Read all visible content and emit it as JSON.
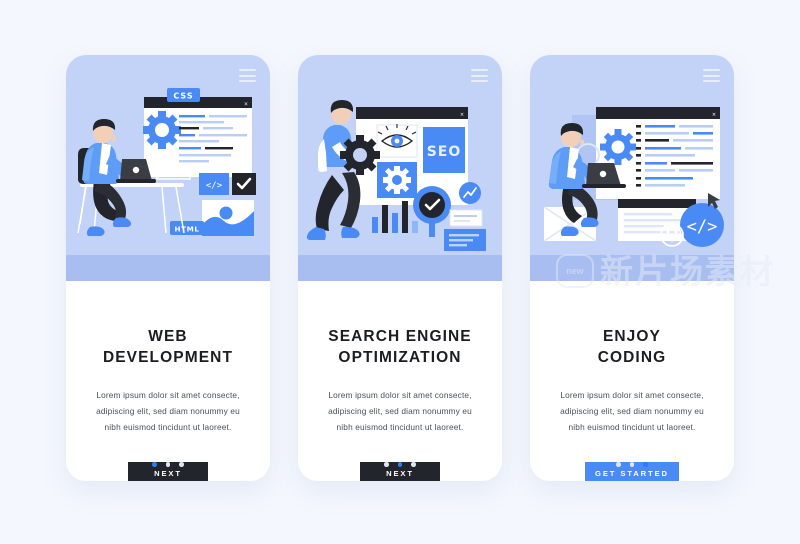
{
  "page": {
    "background_color": "#f4f7fd",
    "card_count": 3
  },
  "theme": {
    "hero_bg": "#c3d2f7",
    "floor_bg": "#a9bef0",
    "accent_blue": "#4a8af4",
    "dark_button": "#22252b",
    "text_dark": "#1b1d22",
    "text_body": "#4a4f5a",
    "dot_inactive": "#dfe4ef",
    "dot_active": "#2f7bf0"
  },
  "shared": {
    "menu_icon": "hamburger-menu-icon",
    "body_text": "Lorem ipsum dolor sit amet consecte,\nadipiscing elit, sed diam nonummy eu\nnibh euismod tincidunt ut laoreet."
  },
  "cards": [
    {
      "id": "web-development",
      "title": "WEB\nDEVELOPMENT",
      "body_text": "Lorem ipsum dolor sit amet consecte,\nadipiscing elit, sed diam nonummy eu\nnibh euismod tincidunt ut laoreet.",
      "button": {
        "label": "NEXT",
        "style": "dark"
      },
      "pagination": {
        "total": 3,
        "active_index": 0
      },
      "illustration": {
        "name": "developer-at-desk-illustration",
        "labels": [
          "CSS",
          "HTML",
          "</>"
        ],
        "elements": [
          "browser-window",
          "gear-icon",
          "laptop",
          "code-tile",
          "check-tile",
          "chart-card",
          "desk",
          "chair"
        ]
      }
    },
    {
      "id": "search-engine-optimization",
      "title": "SEARCH ENGINE\nOPTIMIZATION",
      "body_text": "Lorem ipsum dolor sit amet consecte,\nadipiscing elit, sed diam nonummy eu\nnibh euismod tincidunt ut laoreet.",
      "button": {
        "label": "NEXT",
        "style": "dark"
      },
      "pagination": {
        "total": 3,
        "active_index": 1
      },
      "illustration": {
        "name": "seo-analyst-illustration",
        "labels": [
          "SEO"
        ],
        "elements": [
          "browser-window",
          "eye-icon",
          "gear-icon-held",
          "gear-tile",
          "bar-chart",
          "check-badge",
          "trend-badge",
          "document-card"
        ]
      }
    },
    {
      "id": "enjoy-coding",
      "title": "ENJOY\nCODING",
      "body_text": "Lorem ipsum dolor sit amet consecte,\nadipiscing elit, sed diam nonummy eu\nnibh euismod tincidunt ut laoreet.",
      "button": {
        "label": "GET STARTED",
        "style": "blue"
      },
      "pagination": {
        "total": 3,
        "active_index": 2
      },
      "illustration": {
        "name": "coder-on-box-illustration",
        "labels": [
          "</>"
        ],
        "elements": [
          "browser-window",
          "gear-icon",
          "laptop",
          "code-badge",
          "smiley-icon",
          "document-window",
          "box"
        ]
      }
    }
  ],
  "watermark": {
    "badge_text": "new",
    "text": "新片场素材"
  }
}
